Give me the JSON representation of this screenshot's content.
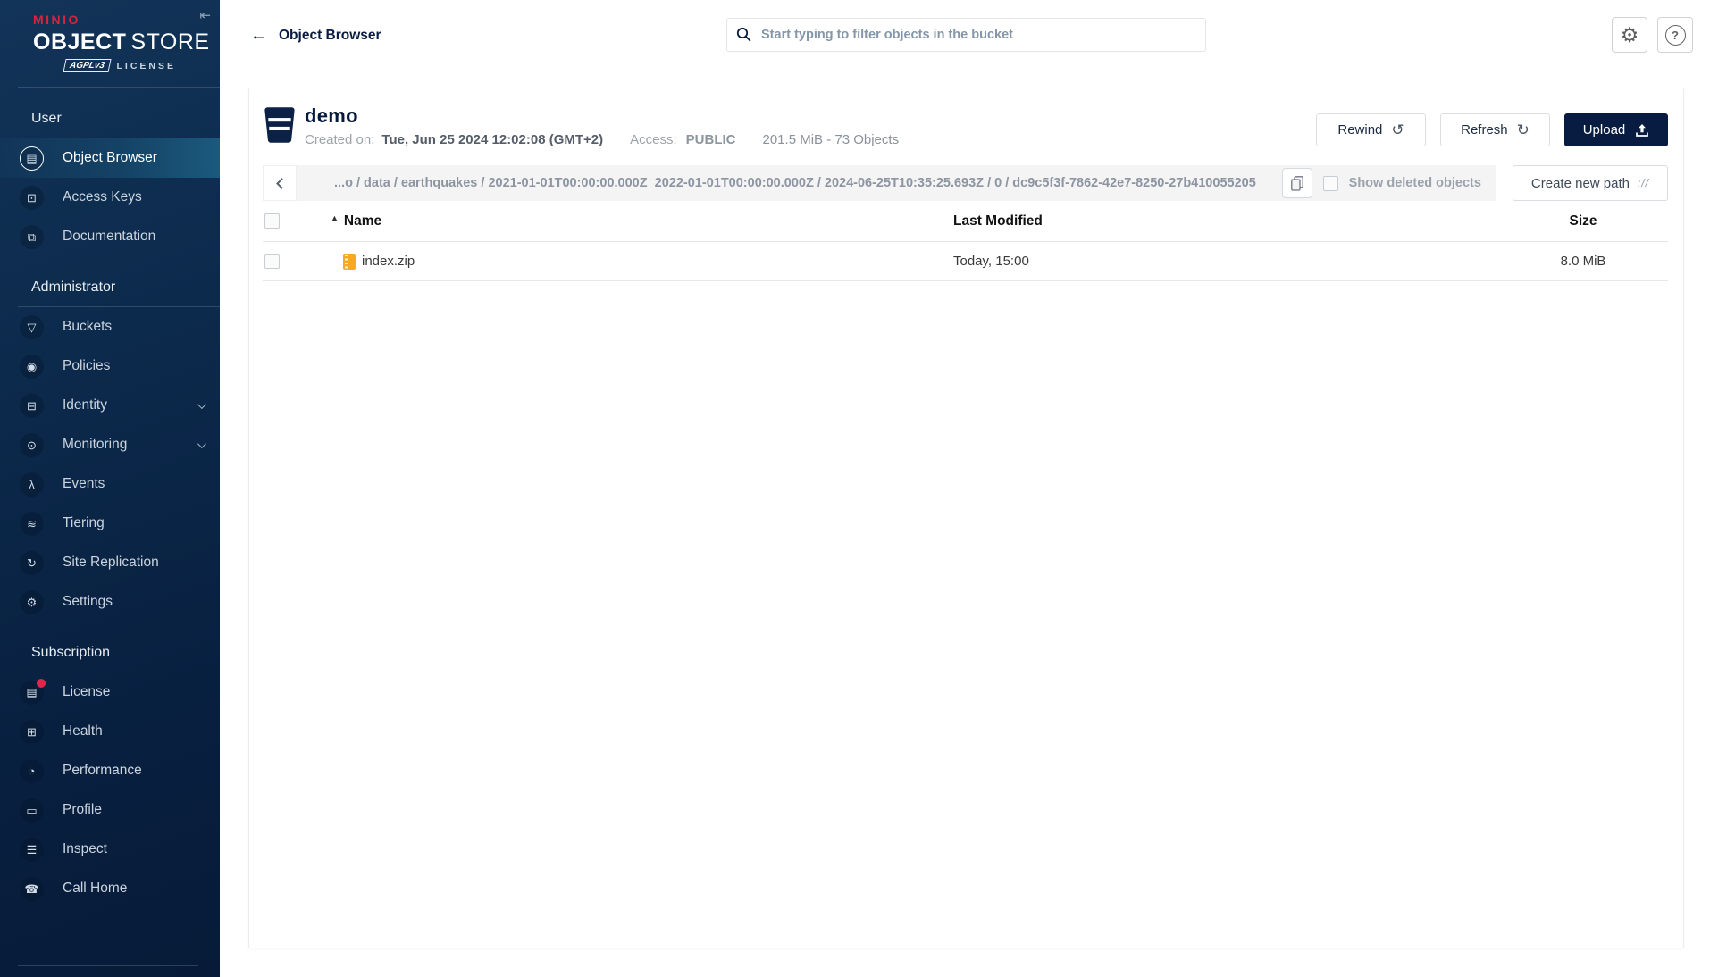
{
  "sidebar": {
    "brand": {
      "minio": "MINIO",
      "product_bold": "OBJECT",
      "product_light": "STORE",
      "badge": "AGPLv3",
      "license": "LICENSE"
    },
    "sections": [
      {
        "label": "User",
        "items": [
          {
            "label": "Object Browser",
            "glyph": "▤",
            "selected": true
          },
          {
            "label": "Access Keys",
            "glyph": "⊡"
          },
          {
            "label": "Documentation",
            "glyph": "⧉"
          }
        ]
      },
      {
        "label": "Administrator",
        "items": [
          {
            "label": "Buckets",
            "glyph": "▽"
          },
          {
            "label": "Policies",
            "glyph": "◉"
          },
          {
            "label": "Identity",
            "glyph": "⊟",
            "expandable": true
          },
          {
            "label": "Monitoring",
            "glyph": "⊙",
            "expandable": true
          },
          {
            "label": "Events",
            "glyph": "λ"
          },
          {
            "label": "Tiering",
            "glyph": "≋"
          },
          {
            "label": "Site Replication",
            "glyph": "↻"
          },
          {
            "label": "Settings",
            "glyph": "⚙"
          }
        ]
      },
      {
        "label": "Subscription",
        "items": [
          {
            "label": "License",
            "glyph": "▤",
            "notification": true
          },
          {
            "label": "Health",
            "glyph": "⊞"
          },
          {
            "label": "Performance",
            "glyph": "◔"
          },
          {
            "label": "Profile",
            "glyph": "▭"
          },
          {
            "label": "Inspect",
            "glyph": "☰"
          },
          {
            "label": "Call Home",
            "glyph": "☎"
          }
        ]
      }
    ]
  },
  "icons": {
    "collapse": "⇤",
    "back": "←",
    "rewind": "↺",
    "refresh": "↻",
    "sort_asc": "▲",
    "new_path": "://"
  },
  "topbar": {
    "title": "Object Browser",
    "search_placeholder": "Start typing to filter objects in the bucket"
  },
  "bucket": {
    "name": "demo",
    "created_label": "Created on:",
    "created_value": "Tue, Jun 25 2024 12:02:08 (GMT+2)",
    "access_label": "Access:",
    "access_value": "PUBLIC",
    "summary": "201.5 MiB - 73 Objects"
  },
  "actions": {
    "rewind": "Rewind",
    "refresh": "Refresh",
    "upload": "Upload",
    "create_new_path": "Create new path",
    "show_deleted_label": "Show deleted objects"
  },
  "breadcrumb": {
    "path": "...o / data / earthquakes / 2021-01-01T00:00:00.000Z_2022-01-01T00:00:00.000Z / 2024-06-25T10:35:25.693Z / 0 / dc9c5f3f-7862-42e7-8250-27b410055205"
  },
  "table": {
    "headers": {
      "name": "Name",
      "modified": "Last Modified",
      "size": "Size"
    },
    "rows": [
      {
        "name": "index.zip",
        "modified": "Today, 15:00",
        "size": "8.0 MiB"
      }
    ]
  },
  "colors": {
    "accent_navy": "#081C42",
    "brand_red": "#D6253C",
    "selected_teal": "#1B5A7D",
    "zip_orange": "#F9A825"
  }
}
